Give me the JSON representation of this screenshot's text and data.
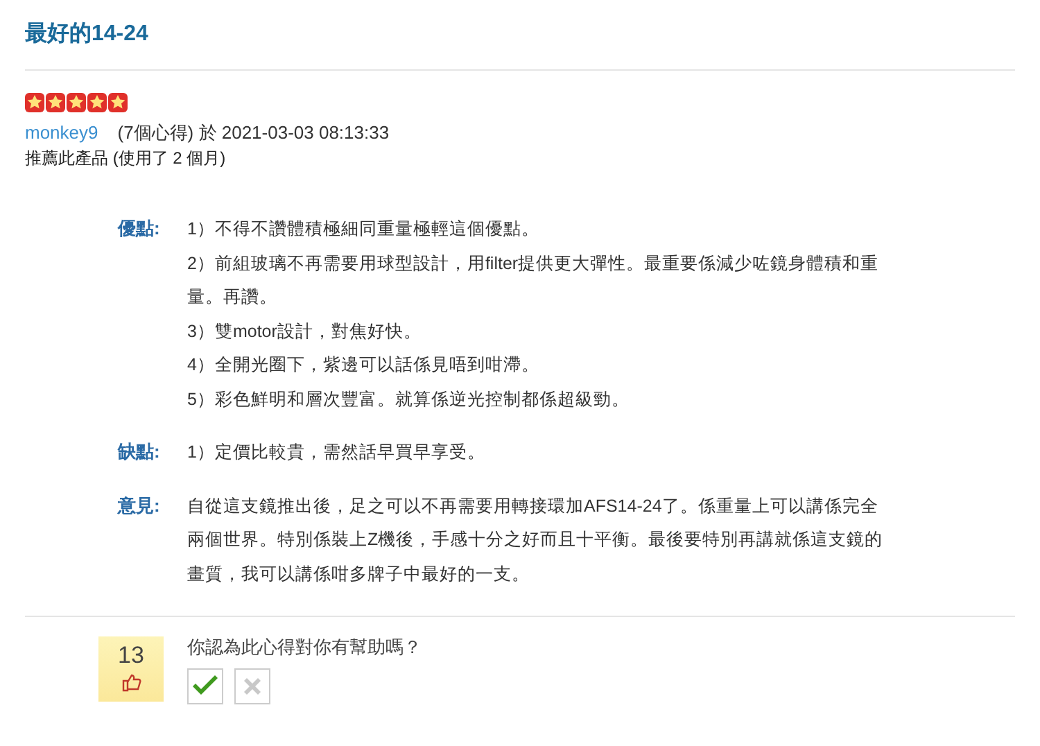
{
  "title": "最好的14-24",
  "review": {
    "stars": 5,
    "author": "monkey9",
    "meta": "(7個心得) 於 2021-03-03 08:13:33",
    "recommendation": "推薦此產品 (使用了 2 個月)"
  },
  "sections": [
    {
      "label": "優點:",
      "paragraphs": [
        "1）不得不讚體積極細同重量極輕這個優點。",
        "2）前組玻璃不再需要用球型設計，用filter提供更大彈性。最重要係減少咗鏡身體積和重量。再讚。",
        "3）雙motor設計，對焦好快。",
        "4）全開光圈下，紫邊可以話係見唔到咁滯。",
        "5）彩色鮮明和層次豐富。就算係逆光控制都係超級勁。"
      ]
    },
    {
      "label": "缺點:",
      "paragraphs": [
        "1）定價比較貴，需然話早買早享受。"
      ]
    },
    {
      "label": "意見:",
      "paragraphs": [
        "自從這支鏡推出後，足之可以不再需要用轉接環加AFS14-24了。係重量上可以講係完全兩個世界。特別係裝上Z機後，手感十分之好而且十平衡。最後要特別再講就係這支鏡的畫質，我可以講係咁多牌子中最好的一支。"
      ]
    }
  ],
  "helpful": {
    "count": "13",
    "question": "你認為此心得對你有幫助嗎？"
  }
}
